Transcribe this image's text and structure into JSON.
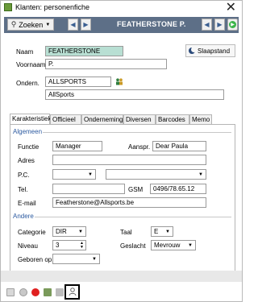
{
  "window": {
    "title": "Klanten: personenfiche"
  },
  "toolbar": {
    "search_label": "Zoeken",
    "record_title": "FEATHERSTONE P."
  },
  "form": {
    "naam_label": "Naam",
    "naam_value": "FEATHERSTONE",
    "voornaam_label": "Voornaam",
    "voornaam_value": "P.",
    "ondern_label": "Ondern.",
    "ondern_value": "ALLSPORTS",
    "ondern_name": "AllSports",
    "slaapstand_label": "Slaapstand"
  },
  "tabs": [
    "Karakteristieken",
    "Officieel",
    "Onderneming",
    "Diversen",
    "Barcodes",
    "Memo"
  ],
  "algemeen": {
    "section_label": "Algemeen",
    "functie_label": "Functie",
    "functie_value": "Manager",
    "aanspr_label": "Aanspr.",
    "aanspr_value": "Dear Paula",
    "adres_label": "Adres",
    "adres_value": "",
    "pc_label": "P.C.",
    "tel_label": "Tel.",
    "tel_value": "",
    "gsm_label": "GSM",
    "gsm_value": "0496/78.65.12",
    "email_label": "E-mail",
    "email_value": "Featherstone@Allsports.be"
  },
  "andere": {
    "section_label": "Andere",
    "categorie_label": "Categorie",
    "categorie_value": "DIR",
    "taal_label": "Taal",
    "taal_value": "E",
    "niveau_label": "Niveau",
    "niveau_value": "3",
    "geslacht_label": "Geslacht",
    "geslacht_value": "Mevrouw",
    "geboren_label": "Geboren op",
    "geboren_value": ""
  },
  "colors": {
    "toolbar_bg": "#5d6f87",
    "highlight_field": "#b8dfd3",
    "section_blue": "#2c5aa0"
  }
}
